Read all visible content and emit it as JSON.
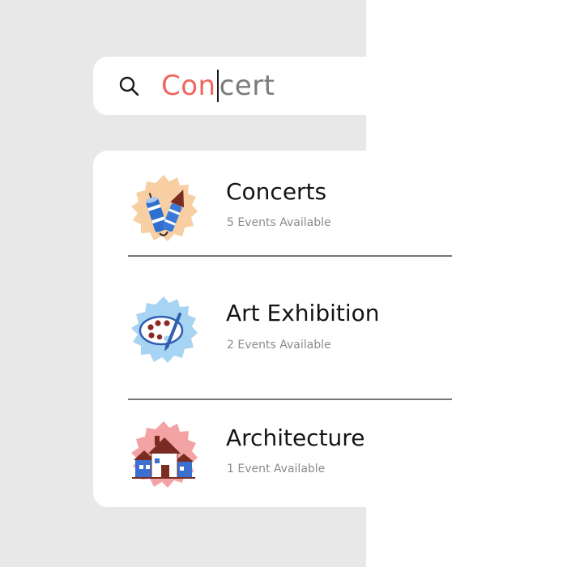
{
  "search": {
    "typed": "Con",
    "suggestion": "cert"
  },
  "results": [
    {
      "label": "Concerts",
      "count": "5 Events Available",
      "icon": "firework-rockets-icon",
      "badge_color": "#f7cfa3"
    },
    {
      "label": "Art Exhibition",
      "count": "2 Events Available",
      "icon": "paint-palette-icon",
      "badge_color": "#a8d4f3"
    },
    {
      "label": "Architecture",
      "count": "1 Event Available",
      "icon": "houses-icon",
      "badge_color": "#f3a3a3"
    }
  ],
  "colors": {
    "accent": "#f0655f",
    "background": "#e8e8e8",
    "card": "#ffffff"
  }
}
